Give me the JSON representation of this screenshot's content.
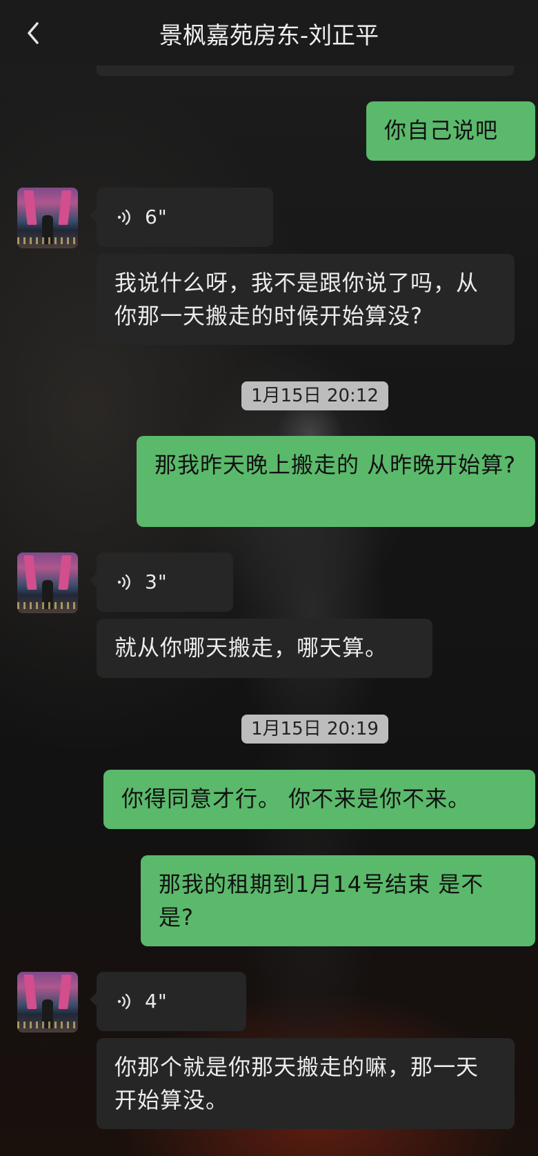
{
  "header": {
    "title": "景枫嘉苑房东-刘正平"
  },
  "messages": [
    {
      "text": "你自己说吧"
    },
    {
      "duration": "6\""
    },
    {
      "text": "我说什么呀，我不是跟你说了吗，从你那一天搬走的时候开始算没?"
    },
    {
      "text": "那我昨天晚上搬走的 从昨晚开始算?"
    },
    {
      "duration": "3\""
    },
    {
      "text": "就从你哪天搬走，哪天算。"
    },
    {
      "text": "你得同意才行。 你不来是你不来。"
    },
    {
      "text": "那我的租期到1月14号结束 是不是?"
    },
    {
      "duration": "4\""
    },
    {
      "text": "你那个就是你那天搬走的嘛，那一天开始算没。"
    }
  ],
  "timestamps": [
    "1月15日 20:12",
    "1月15日 20:19"
  ],
  "colors": {
    "outgoing_bubble": "#5bb96b",
    "incoming_bubble": "#262626",
    "timestamp_bg": "#bdbdbd"
  }
}
